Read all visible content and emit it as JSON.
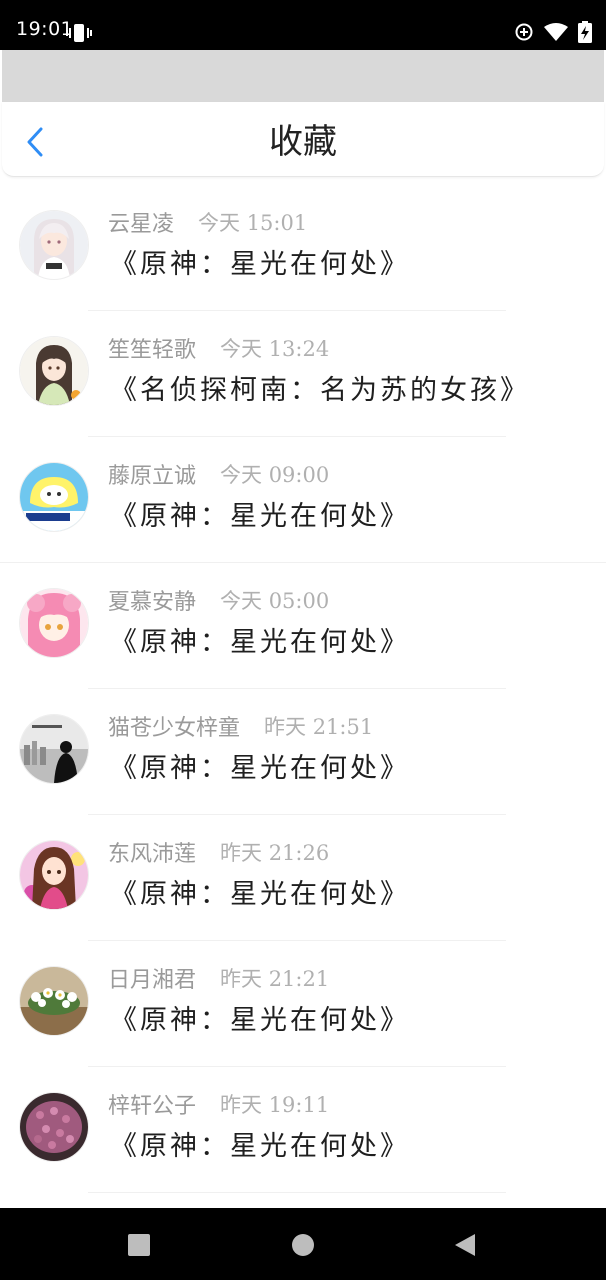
{
  "status_bar": {
    "time": "19:01",
    "icons": [
      "vibrate-icon",
      "data-saver-icon",
      "wifi-icon",
      "battery-charging-icon"
    ]
  },
  "header": {
    "back_icon": "chevron-left-icon",
    "title": "收藏",
    "accent_color": "#2f8df5"
  },
  "favorites": [
    {
      "user": "云星凌",
      "time": "今天 15:01",
      "title": "《原神：星光在何处》",
      "avatar": "anime-girl-white-hair"
    },
    {
      "user": "笙笙轻歌",
      "time": "今天 13:24",
      "title": "《名侦探柯南：名为苏的女孩》",
      "avatar": "anime-girl-dark-hair"
    },
    {
      "user": "藤原立诚",
      "time": "今天 09:00",
      "title": "《原神：星光在何处》",
      "avatar": "gemini-cartoon"
    },
    {
      "user": "夏慕安静",
      "time": "今天 05:00",
      "title": "《原神：星光在何处》",
      "avatar": "anime-girl-pink-hair"
    },
    {
      "user": "猫苍少女梓童",
      "time": "昨天 21:51",
      "title": "《原神：星光在何处》",
      "avatar": "silhouette-grayscale"
    },
    {
      "user": "东风沛莲",
      "time": "昨天 21:26",
      "title": "《原神：星光在何处》",
      "avatar": "anime-girl-colorful"
    },
    {
      "user": "日月湘君",
      "time": "昨天 21:21",
      "title": "《原神：星光在何处》",
      "avatar": "white-flowers"
    },
    {
      "user": "梓轩公子",
      "time": "昨天 19:11",
      "title": "《原神：星光在何处》",
      "avatar": "purple-flowers"
    }
  ],
  "nav_bar": {
    "buttons": [
      "recents-square-icon",
      "home-circle-icon",
      "back-triangle-icon"
    ]
  }
}
